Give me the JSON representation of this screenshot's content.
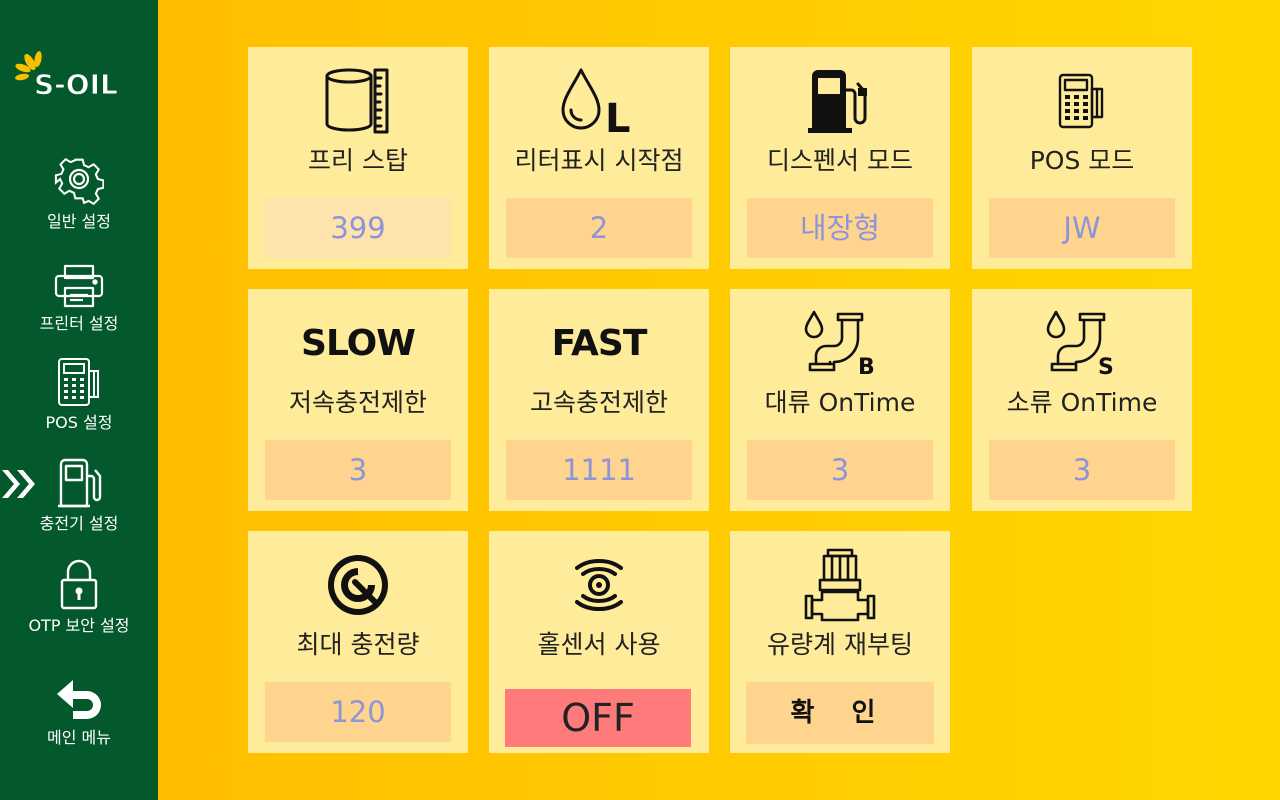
{
  "brand": {
    "name": "S-OIL",
    "logo_text": "S-OIL",
    "colors": {
      "green": "#03592b",
      "yellow": "#ffc800",
      "card": "#ffec9a",
      "value_bg": "#ffd48f",
      "off_red": "#ff7a7a"
    }
  },
  "sidebar": {
    "items": [
      {
        "label": "일반 설정",
        "icon": "gear-icon"
      },
      {
        "label": "프린터 설정",
        "icon": "printer-icon"
      },
      {
        "label": "POS 설정",
        "icon": "pos-terminal-icon"
      },
      {
        "label": "충전기 설정",
        "icon": "fuel-pump-icon",
        "active": true
      },
      {
        "label": "OTP 보안 설정",
        "icon": "lock-icon"
      },
      {
        "label": "메인 메뉴",
        "icon": "back-arrow-icon"
      }
    ]
  },
  "cards": [
    {
      "title": "프리 스탑",
      "value": "399",
      "icon": "tank-gauge-icon"
    },
    {
      "title": "리터표시 시작점",
      "value": "2",
      "icon": "drop-liter-icon",
      "icon_text": "L"
    },
    {
      "title": "디스펜서 모드",
      "value": "내장형",
      "icon": "fuel-pump-icon"
    },
    {
      "title": "POS 모드",
      "value": "JW",
      "icon": "pos-terminal-icon"
    },
    {
      "title": "저속충전제한",
      "value": "3",
      "big_text": "SLOW"
    },
    {
      "title": "고속충전제한",
      "value": "1111",
      "big_text": "FAST"
    },
    {
      "title": "대류 OnTime",
      "value": "3",
      "icon": "pipe-drop-icon",
      "icon_text": "B"
    },
    {
      "title": "소류 OnTime",
      "value": "3",
      "icon": "pipe-drop-icon",
      "icon_text": "S"
    },
    {
      "title": "최대 충전량",
      "value": "120",
      "icon": "gauge-dial-icon"
    },
    {
      "title": "홀센서 사용",
      "value": "OFF",
      "icon": "sensor-wave-icon"
    },
    {
      "title": "유량계 재부팅",
      "value": "확 인",
      "icon": "flow-meter-icon"
    }
  ]
}
